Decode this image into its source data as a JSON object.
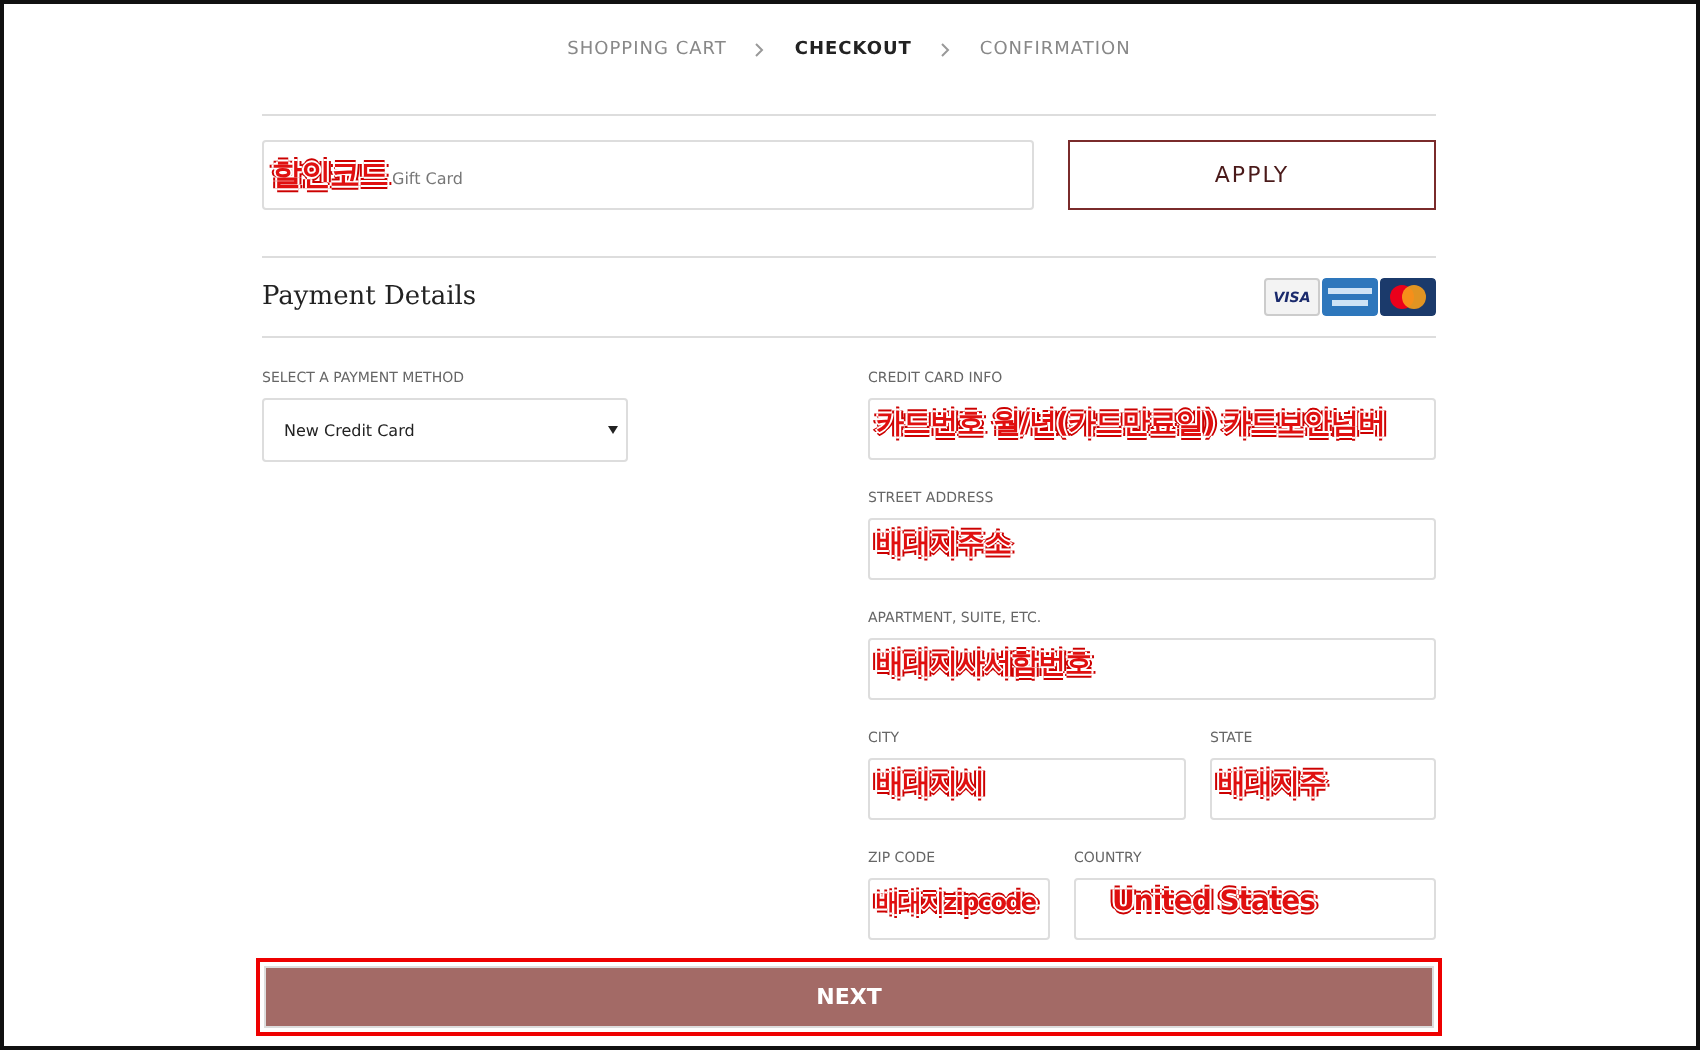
{
  "breadcrumb": [
    {
      "label": "SHOPPING CART",
      "selected": false
    },
    {
      "label": "CHECKOUT",
      "selected": true
    },
    {
      "label": "CONFIRMATION",
      "selected": false
    }
  ],
  "gift_card": {
    "placeholder": "Gift Card",
    "annotation": "할인코드",
    "button": "APPLY"
  },
  "payment": {
    "title": "Payment Details",
    "card_logos": [
      {
        "kind": "visa",
        "label": "VISA"
      },
      {
        "kind": "amex"
      },
      {
        "kind": "mastercard"
      }
    ]
  },
  "payment_method": {
    "label": "SELECT A PAYMENT METHOD",
    "value": "New Credit Card"
  },
  "fields": [
    {
      "label": "CREDIT CARD INFO",
      "annotation": "카드번호  월/년(카드만료일) 카드보안넘버",
      "kind": "full"
    },
    {
      "label": "STREET ADDRESS",
      "annotation": "배대지주소",
      "kind": "full"
    },
    {
      "label": "APARTMENT, SUITE, ETC.",
      "annotation": "배대지사서함번호",
      "kind": "full"
    },
    {
      "label": "CITY",
      "annotation": "배대지시",
      "kind": "wide"
    },
    {
      "label": "STATE",
      "annotation": "배대지주",
      "kind": "narrow"
    },
    {
      "label": "ZIP CODE",
      "annotation": "배대지zipcode",
      "kind": "small"
    },
    {
      "label": "COUNTRY",
      "annotation": "United States",
      "kind": "large"
    }
  ],
  "next_button": {
    "label": "NEXT",
    "highlighted": true
  }
}
